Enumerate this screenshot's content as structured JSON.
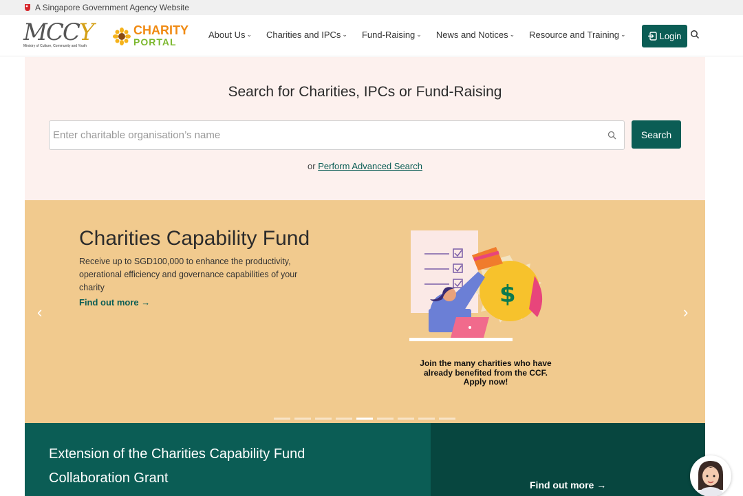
{
  "masthead": {
    "text": "A Singapore Government Agency Website"
  },
  "logos": {
    "mccy_text": "MCCY",
    "mccy_subtitle": "Ministry of Culture, Community and Youth",
    "charity_line1": "CHARITY",
    "charity_line2": "PORTAL"
  },
  "nav": {
    "items": [
      {
        "label": "About Us"
      },
      {
        "label": "Charities and IPCs"
      },
      {
        "label": "Fund-Raising"
      },
      {
        "label": "News and Notices"
      },
      {
        "label": "Resource and Training"
      }
    ],
    "login_label": "Login"
  },
  "search": {
    "title": "Search for Charities, IPCs or Fund-Raising",
    "placeholder": "Enter charitable organisation’s name",
    "value": "",
    "button_label": "Search",
    "advanced_prefix": "or",
    "advanced_link": "Perform Advanced Search"
  },
  "carousel": {
    "title": "Charities Capability Fund",
    "description": "Receive up to SGD100,000 to enhance the productivity, operational efficiency and governance capabilities of your charity",
    "link": "Find out more →",
    "caption_line1": "Join the many charities who have",
    "caption_line2": "already benefited from the CCF.",
    "caption_line3": "Apply now!",
    "prev_icon": "chevron-left-icon",
    "next_icon": "chevron-right-icon",
    "slide_count": 9,
    "active_slide": 5
  },
  "banner": {
    "title_line1": "Extension of the Charities Capability Fund",
    "title_line2": "Collaboration Grant",
    "link": "Find out more →"
  },
  "colors": {
    "primary": "#0b5d55",
    "search_bg": "#fdf1ee",
    "carousel_bg": "#f1ca8e",
    "banner_dark": "#07463f",
    "charity_orange": "#f08a12",
    "portal_green": "#7cb82f"
  }
}
